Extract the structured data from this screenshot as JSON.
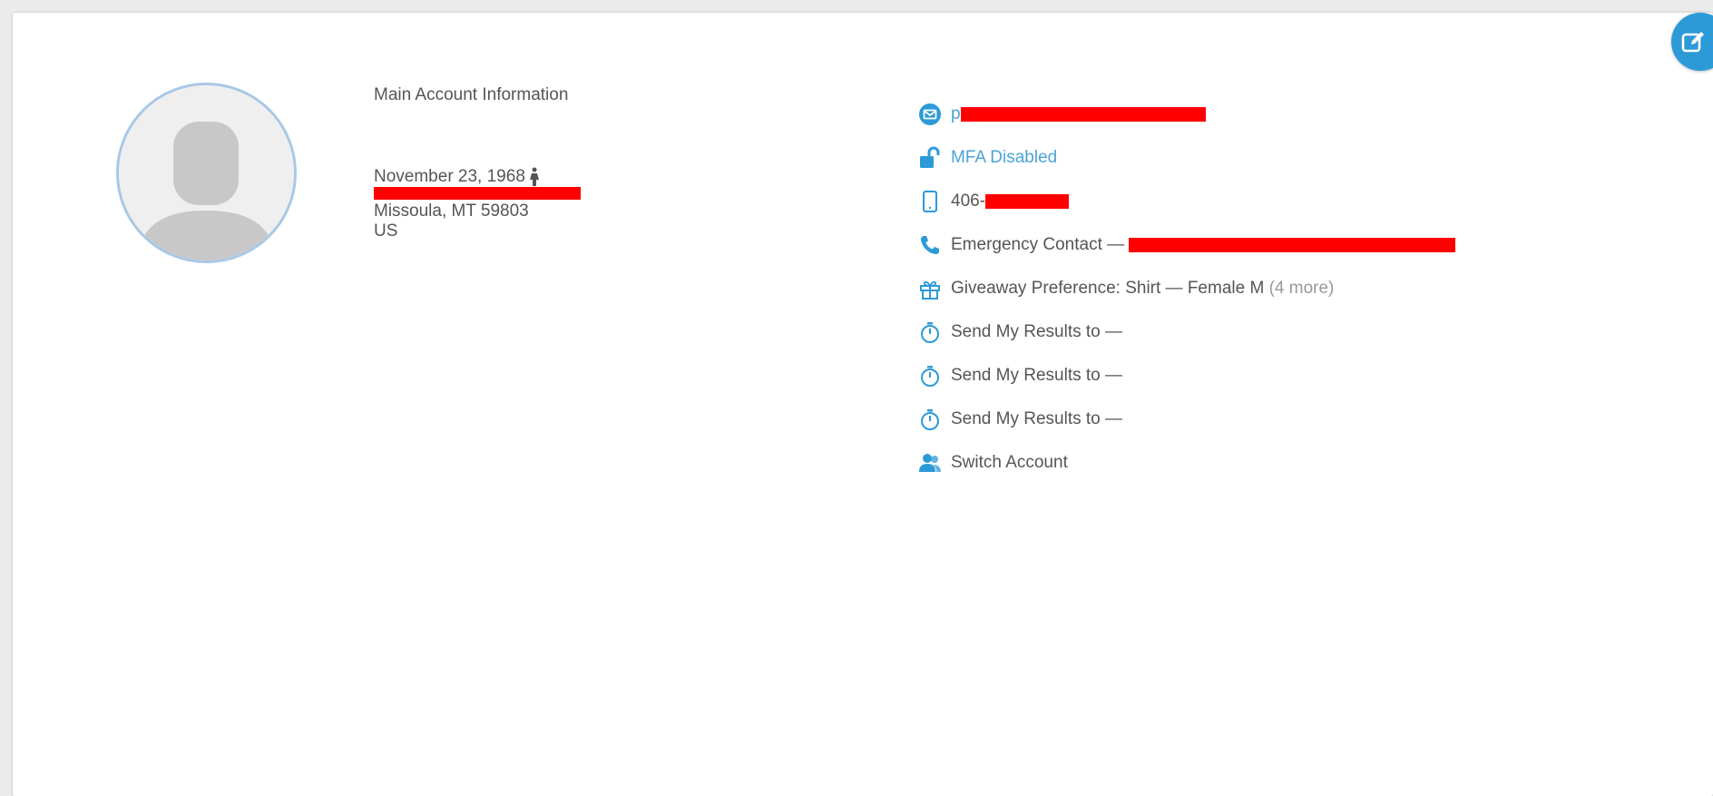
{
  "profile": {
    "section_title": "Main Account Information",
    "dob": "November 23, 1968",
    "city_line": "Missoula, MT 59803",
    "country": "US"
  },
  "details": {
    "email_prefix": "p",
    "mfa_status": "MFA Disabled",
    "phone_prefix": "406-",
    "emergency_label": "Emergency Contact —",
    "giveaway_label": "Giveaway Preference: Shirt — Female M",
    "giveaway_more": "(4 more)",
    "send_results": [
      "Send My Results to —",
      "Send My Results to —",
      "Send My Results to —"
    ],
    "switch_account": "Switch Account"
  },
  "colors": {
    "accent": "#2d9ad8",
    "link": "#4ba3d9",
    "redaction": "#ff0000"
  },
  "icons": {
    "avatar": "default-user-avatar",
    "edit": "edit-icon",
    "email": "email-icon",
    "mfa": "unlock-icon",
    "phone": "mobile-phone-icon",
    "emergency": "phone-icon",
    "giveaway": "gift-icon",
    "results": "stopwatch-icon",
    "switch": "users-icon"
  }
}
